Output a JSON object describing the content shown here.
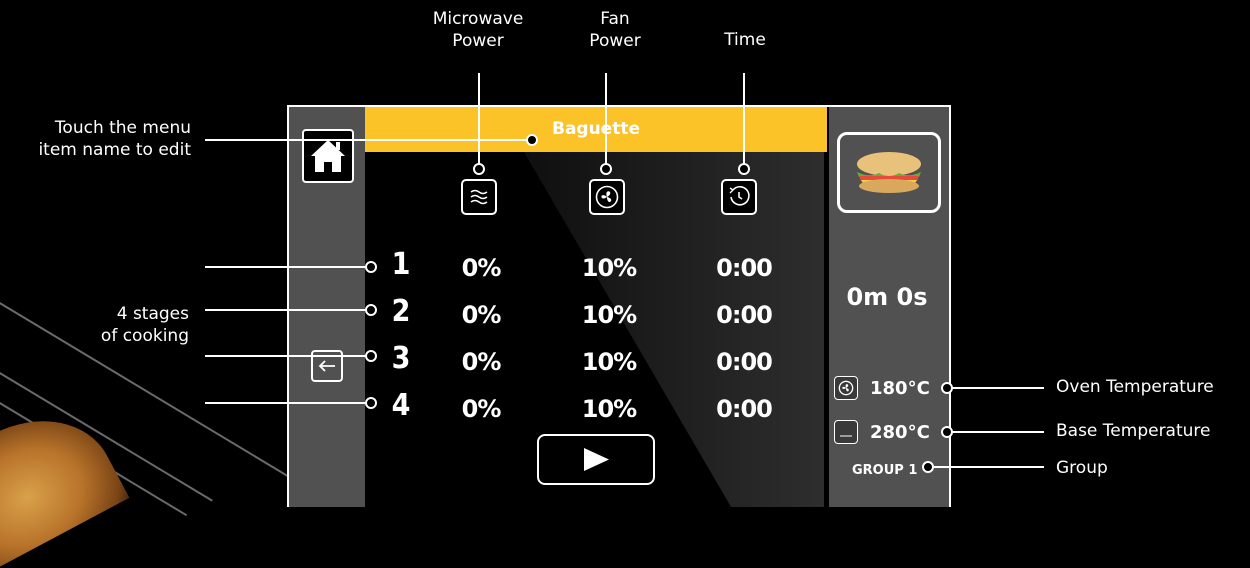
{
  "menu_item_name": "Baguette",
  "columns": [
    {
      "label": "Microwave\nPower",
      "icon": "microwave-waves-icon"
    },
    {
      "label": "Fan\nPower",
      "icon": "fan-icon"
    },
    {
      "label": "Time",
      "icon": "timer-icon"
    }
  ],
  "stages": [
    {
      "num": "1",
      "microwave": "0%",
      "fan": "10%",
      "time": "0:00"
    },
    {
      "num": "2",
      "microwave": "0%",
      "fan": "10%",
      "time": "0:00"
    },
    {
      "num": "3",
      "microwave": "0%",
      "fan": "10%",
      "time": "0:00"
    },
    {
      "num": "4",
      "microwave": "0%",
      "fan": "10%",
      "time": "0:00"
    }
  ],
  "total_time": "0m 0s",
  "oven_temperature": "180°C",
  "base_temperature": "280°C",
  "group": "GROUP 1",
  "annotations": {
    "edit_name": "Touch the menu\nitem name to edit",
    "stages": "4 stages\nof cooking",
    "oven_temperature": "Oven Temperature",
    "base_temperature": "Base Temperature",
    "group": "Group"
  },
  "colors": {
    "title_bar": "#fbc327",
    "panel": "#515151",
    "background": "#000000"
  },
  "icons": [
    "home-icon",
    "back-arrow-icon",
    "sandwich-icon",
    "play-icon",
    "fan-icon",
    "element-icon"
  ]
}
